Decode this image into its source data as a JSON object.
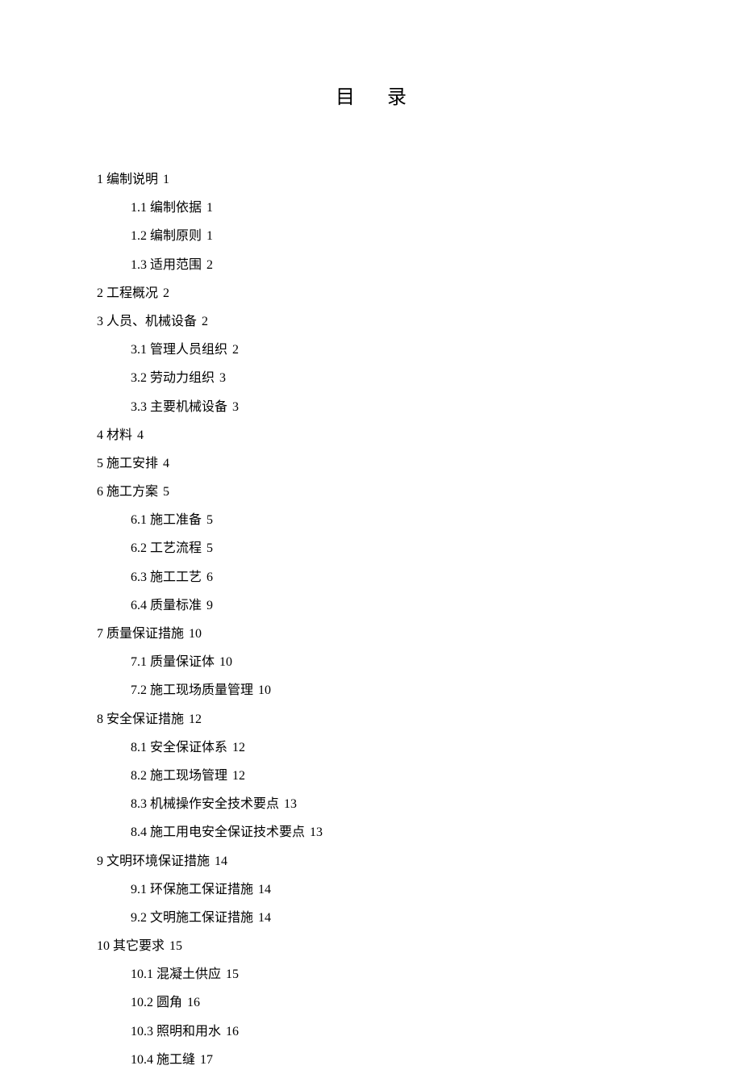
{
  "title": "目录",
  "toc": [
    {
      "level": 1,
      "num": "1",
      "label": "编制说明",
      "page": "1"
    },
    {
      "level": 2,
      "num": "1.1",
      "label": "编制依据",
      "page": "1"
    },
    {
      "level": 2,
      "num": "1.2",
      "label": "编制原则",
      "page": "1"
    },
    {
      "level": 2,
      "num": "1.3",
      "label": "适用范围",
      "page": "2"
    },
    {
      "level": 1,
      "num": "2",
      "label": "工程概况",
      "page": "2"
    },
    {
      "level": 1,
      "num": "3",
      "label": "人员、机械设备",
      "page": "2"
    },
    {
      "level": 2,
      "num": "3.1",
      "label": "管理人员组织",
      "page": "2"
    },
    {
      "level": 2,
      "num": "3.2",
      "label": "劳动力组织",
      "page": "3"
    },
    {
      "level": 2,
      "num": "3.3",
      "label": "主要机械设备",
      "page": "3"
    },
    {
      "level": 1,
      "num": "4",
      "label": "材料",
      "page": "4"
    },
    {
      "level": 1,
      "num": "5",
      "label": "施工安排",
      "page": "4"
    },
    {
      "level": 1,
      "num": "6",
      "label": "施工方案",
      "page": "5"
    },
    {
      "level": 2,
      "num": "6.1",
      "label": "施工准备",
      "page": "5"
    },
    {
      "level": 2,
      "num": "6.2",
      "label": "工艺流程",
      "page": "5"
    },
    {
      "level": 2,
      "num": "6.3",
      "label": "施工工艺",
      "page": "6"
    },
    {
      "level": 2,
      "num": "6.4",
      "label": "质量标准",
      "page": "9"
    },
    {
      "level": 1,
      "num": "7",
      "label": "质量保证措施",
      "page": "10"
    },
    {
      "level": 2,
      "num": "7.1",
      "label": "质量保证体",
      "page": "10"
    },
    {
      "level": 2,
      "num": "7.2",
      "label": "施工现场质量管理",
      "page": "10"
    },
    {
      "level": 1,
      "num": "8",
      "label": "安全保证措施",
      "page": "12"
    },
    {
      "level": 2,
      "num": "8.1",
      "label": "安全保证体系",
      "page": "12"
    },
    {
      "level": 2,
      "num": "8.2",
      "label": "施工现场管理",
      "page": "12"
    },
    {
      "level": 2,
      "num": "8.3",
      "label": "机械操作安全技术要点",
      "page": "13"
    },
    {
      "level": 2,
      "num": "8.4",
      "label": "施工用电安全保证技术要点",
      "page": "13"
    },
    {
      "level": 1,
      "num": "9",
      "label": "文明环境保证措施",
      "page": "14"
    },
    {
      "level": 2,
      "num": "9.1",
      "label": "环保施工保证措施",
      "page": "14"
    },
    {
      "level": 2,
      "num": "9.2",
      "label": "文明施工保证措施",
      "page": "14"
    },
    {
      "level": 1,
      "num": "10",
      "label": "其它要求",
      "page": "15"
    },
    {
      "level": 2,
      "num": "10.1",
      "label": "混凝土供应",
      "page": "15"
    },
    {
      "level": 2,
      "num": "10.2",
      "label": "圆角",
      "page": "16"
    },
    {
      "level": 2,
      "num": "10.3",
      "label": "照明和用水",
      "page": "16"
    },
    {
      "level": 2,
      "num": "10.4",
      "label": "施工缝",
      "page": "17"
    }
  ]
}
